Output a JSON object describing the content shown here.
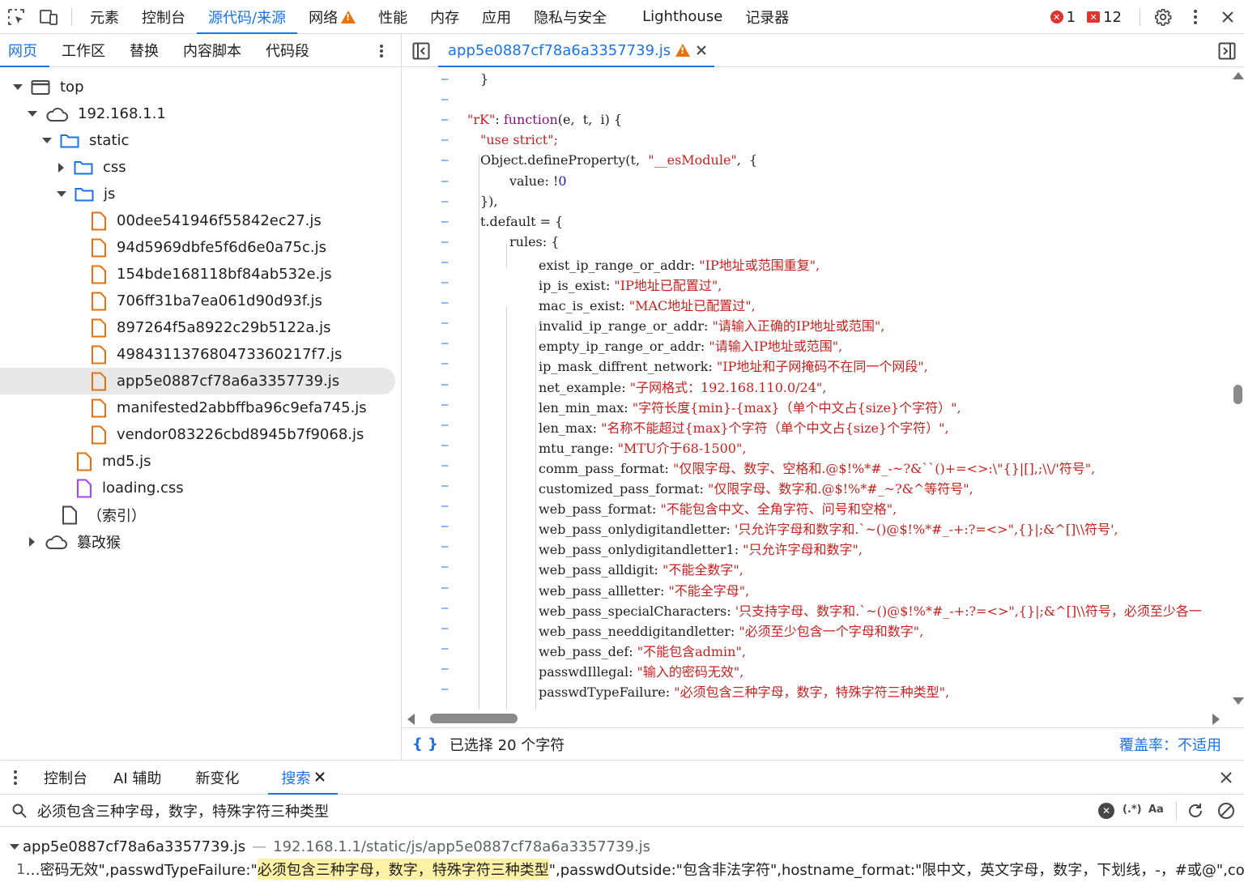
{
  "toolbar": {
    "tabs": [
      "元素",
      "控制台",
      "源代码/来源",
      "网络",
      "性能",
      "内存",
      "应用",
      "隐私与安全",
      "Lighthouse",
      "记录器"
    ],
    "errors_count": "1",
    "warnings_count": "12"
  },
  "navigator": {
    "tabs": [
      "网页",
      "工作区",
      "替换",
      "内容脚本",
      "代码段"
    ],
    "tree": {
      "top": "top",
      "host": "192.168.1.1",
      "static": "static",
      "css": "css",
      "js": "js",
      "files": [
        "00dee541946f55842ec27.js",
        "94d5969dbfe5f6d6e0a75c.js",
        "154bde168118bf84ab532e.js",
        "706ff31ba7ea061d90d93f.js",
        "897264f5a8922c29b5122a.js",
        "498431137680473360217f7.js",
        "app5e0887cf78a6a3357739.js",
        "manifested2abbffba96c9efa745.js",
        "vendor083226cbd8945b7f9068.js"
      ],
      "md5": "md5.js",
      "loading": "loading.css",
      "index": "（索引）",
      "tampermonkey": "篡改猴"
    }
  },
  "editor": {
    "tab_label": "app5e0887cf78a6a3357739.js",
    "lines": [
      {
        "key": "exist_ip_range_or_addr",
        "val": "\"IP地址或范围重复\","
      },
      {
        "key": "ip_is_exist",
        "val": "\"IP地址已配置过\","
      },
      {
        "key": "mac_is_exist",
        "val": "\"MAC地址已配置过\","
      },
      {
        "key": "invalid_ip_range_or_addr",
        "val": "\"请输入正确的IP地址或范围\","
      },
      {
        "key": "empty_ip_range_or_addr",
        "val": "\"请输入IP地址或范围\","
      },
      {
        "key": "ip_mask_diffrent_network",
        "val": "\"IP地址和子网掩码不在同一个网段\","
      },
      {
        "key": "net_example",
        "val": "\"子网格式：192.168.110.0/24\","
      },
      {
        "key": "len_min_max",
        "val": "\"字符长度{min}-{max}（单个中文占{size}个字符）\","
      },
      {
        "key": "len_max",
        "val": "\"名称不能超过{max}个字符（单个中文占{size}个字符）\","
      },
      {
        "key": "mtu_range",
        "val": "\"MTU介于68-1500\","
      },
      {
        "key": "comm_pass_format",
        "val": "\"仅限字母、数字、空格和.@$!%*#_-~?&``()+=<>:\\\"{}|[],;\\\\/'符号\","
      },
      {
        "key": "customized_pass_format",
        "val": "\"仅限字母、数字和.@$!%*#_~?&^等符号\","
      },
      {
        "key": "web_pass_format",
        "val": "\"不能包含中文、全角字符、问号和空格\","
      },
      {
        "key": "web_pass_onlydigitandletter",
        "val": "'只允许字母和数字和.`~()@$!%*#_-+:?=<>\",{}|;&^[]\\\\符号',"
      },
      {
        "key": "web_pass_onlydigitandletter1",
        "val": "\"只允许字母和数字\","
      },
      {
        "key": "web_pass_alldigit",
        "val": "\"不能全数字\","
      },
      {
        "key": "web_pass_allletter",
        "val": "\"不能全字母\","
      },
      {
        "key": "web_pass_specialCharacters",
        "val": "'只支持字母、数字和.`~()@$!%*#_-+:?=<>\",{}|;&^[]\\\\符号，必须至少各一"
      },
      {
        "key": "web_pass_needdigitandletter",
        "val": "\"必须至少包含一个字母和数字\","
      },
      {
        "key": "web_pass_def",
        "val": "\"不能包含admin\","
      },
      {
        "key": "passwdIllegal",
        "val": "\"输入的密码无效\","
      },
      {
        "key": "passwdTypeFailure",
        "val": "\"必须包含三种字母，数字，特殊字符三种类型\","
      }
    ],
    "header_lines": {
      "close_brace": "}",
      "rk_key": "\"rK\"",
      "rk_fn": "function",
      "rk_params": "(e,  t,  i) {",
      "use_strict": "\"use strict\";",
      "define": "Object.defineProperty(t,  ",
      "esmodule": "\"__esModule\"",
      "define_end": ",  {",
      "value": "value: !",
      "value_num": "0",
      "close_obj": "}),",
      "tdefault": "t.default = {",
      "rules": "rules: {"
    },
    "status_selected": "已选择 20 个字符",
    "coverage": "覆盖率：不适用"
  },
  "drawer": {
    "tabs": [
      "控制台",
      "AI 辅助",
      "新变化",
      "搜索"
    ],
    "search_query": "必须包含三种字母，数字，特殊字符三种类型",
    "result_file": "app5e0887cf78a6a3357739.js",
    "result_path": "192.168.1.1/static/js/app5e0887cf78a6a3357739.js",
    "result_line_no": "1",
    "result_pre": "…密码无效\",passwdTypeFailure:\"",
    "result_match": "必须包含三种字母，数字，特殊字符三种类型",
    "result_post": "\",passwdOutside:\"包含非法字符\",hostname_format:\"限中文，英文字母，数字，下划线，-，#或@\",co…",
    "regex_label": "(.*)",
    "case_label": "Aa"
  }
}
